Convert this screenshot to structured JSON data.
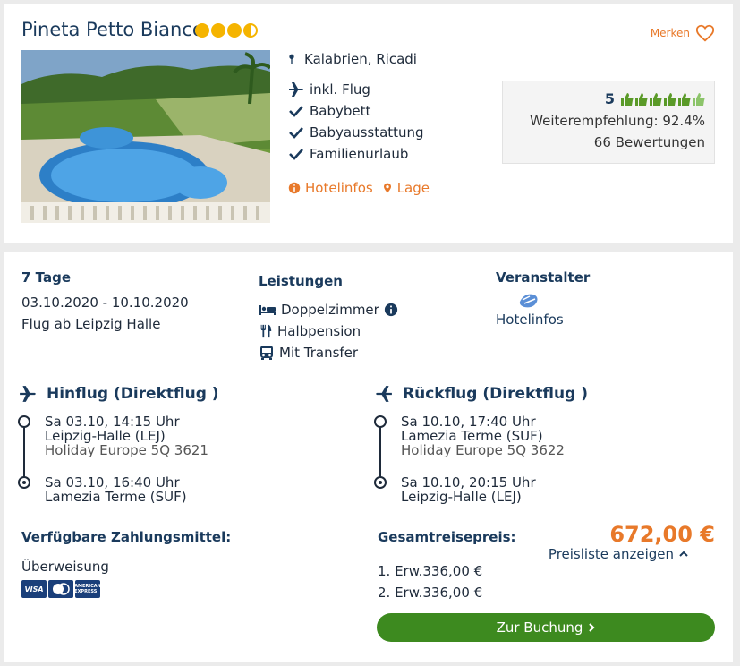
{
  "hotel": {
    "name": "Pineta Petto Bianco",
    "stars": 3.5,
    "location": "Kalabrien, Ricadi",
    "features": [
      "inkl. Flug",
      "Babybett",
      "Babyausstattung",
      "Familienurlaub"
    ],
    "links": {
      "info": "Hotelinfos",
      "map": "Lage"
    },
    "bookmark_label": "Merken"
  },
  "rating": {
    "score": "5",
    "thumbs": 6,
    "recommendation": "Weiterempfehlung: 92.4%",
    "reviews": "66 Bewertungen"
  },
  "trip": {
    "duration": "7 Tage",
    "dates": "03.10.2020 - 10.10.2020",
    "departure": "Flug ab Leipzig Halle"
  },
  "leistungen": {
    "heading": "Leistungen",
    "items": [
      "Doppelzimmer",
      "Halbpension",
      "Mit Transfer"
    ]
  },
  "veranstalter": {
    "heading": "Veranstalter",
    "link": "Hotelinfos"
  },
  "outbound": {
    "heading": "Hinflug (Direktflug )",
    "dep_time": "Sa 03.10, 14:15 Uhr",
    "dep_airport": "Leipzig-Halle (LEJ)",
    "airline": "Holiday Europe 5Q 3621",
    "arr_time": "Sa 03.10, 16:40 Uhr",
    "arr_airport": "Lamezia Terme (SUF)"
  },
  "return": {
    "heading": "Rückflug (Direktflug )",
    "dep_time": "Sa 10.10, 17:40 Uhr",
    "dep_airport": "Lamezia Terme (SUF)",
    "airline": "Holiday Europe 5Q 3622",
    "arr_time": "Sa 10.10, 20:15 Uhr",
    "arr_airport": "Leipzig-Halle (LEJ)"
  },
  "payment": {
    "heading": "Verfügbare Zahlungsmittel:",
    "method": "Überweisung",
    "cards": [
      "VISA",
      "MC",
      "AMEX"
    ]
  },
  "price": {
    "heading": "Gesamtreisepreis:",
    "total": "672,00 €",
    "pricelist_link": "Preisliste anzeigen",
    "lines": [
      "1. Erw.336,00 €",
      "2. Erw.336,00 €"
    ]
  },
  "cta": {
    "label": "Zur Buchung"
  },
  "colors": {
    "accent": "#e8792a",
    "primary": "#1a3a5c",
    "cta": "#3d8a1f",
    "star": "#f5b400"
  }
}
